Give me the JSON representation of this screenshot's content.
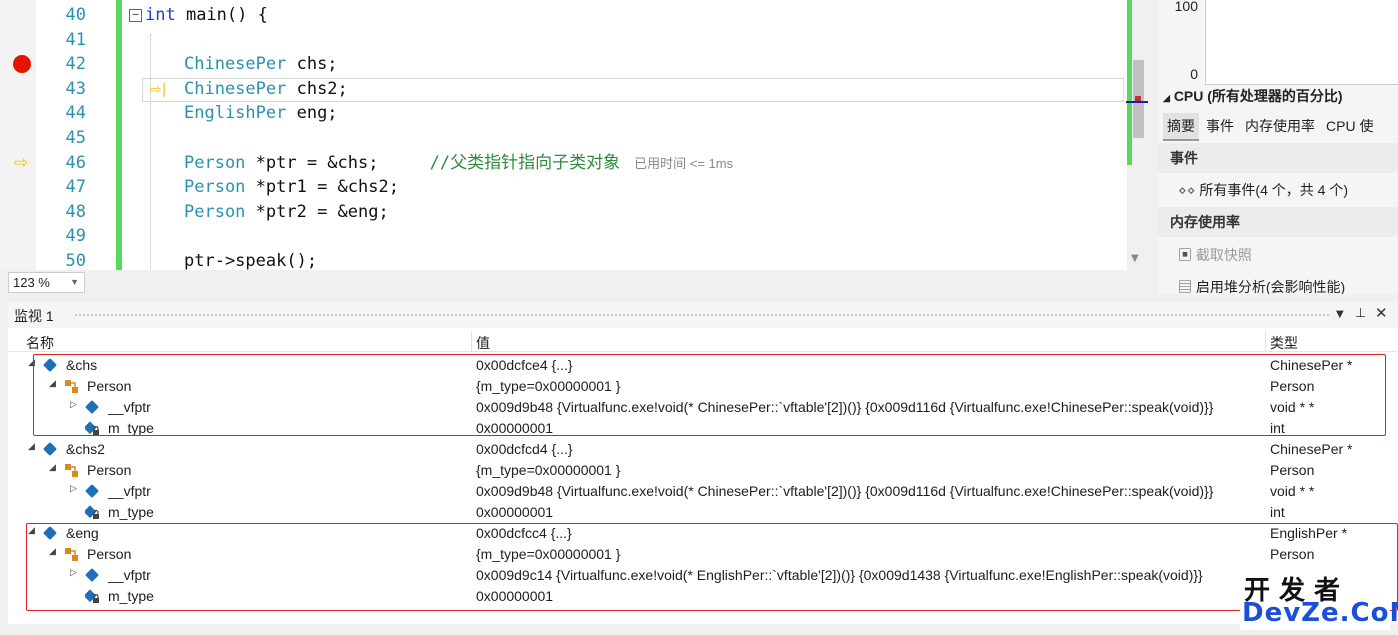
{
  "editor": {
    "zoom": "123 %",
    "lines": [
      {
        "num": "40",
        "segments": [
          {
            "t": "int",
            "c": "kw"
          },
          {
            "t": " main() {",
            "c": ""
          }
        ]
      },
      {
        "num": "41",
        "segments": []
      },
      {
        "num": "42",
        "segments": [
          {
            "t": "ChinesePer",
            "c": "ty"
          },
          {
            "t": " chs;",
            "c": ""
          }
        ]
      },
      {
        "num": "43",
        "segments": [
          {
            "t": "ChinesePer",
            "c": "ty"
          },
          {
            "t": " chs2;",
            "c": ""
          }
        ]
      },
      {
        "num": "44",
        "segments": [
          {
            "t": "EnglishPer",
            "c": "ty"
          },
          {
            "t": " eng;",
            "c": ""
          }
        ]
      },
      {
        "num": "45",
        "segments": []
      },
      {
        "num": "46",
        "segments": [
          {
            "t": "Person",
            "c": "ty"
          },
          {
            "t": " *ptr = &chs;     ",
            "c": ""
          },
          {
            "t": "//父类指针指向子类对象",
            "c": "cm"
          }
        ]
      },
      {
        "num": "47",
        "segments": [
          {
            "t": "Person",
            "c": "ty"
          },
          {
            "t": " *ptr1 = &chs2;",
            "c": ""
          }
        ]
      },
      {
        "num": "48",
        "segments": [
          {
            "t": "Person",
            "c": "ty"
          },
          {
            "t": " *ptr2 = &eng;",
            "c": ""
          }
        ]
      },
      {
        "num": "49",
        "segments": []
      },
      {
        "num": "50",
        "segments": [
          {
            "t": "ptr->speak();",
            "c": ""
          }
        ]
      }
    ],
    "elapsed_hint": "已用时间 <= 1ms",
    "collapse_glyph": "−",
    "step_glyph": "⇨|",
    "next_glyph": "⇨"
  },
  "diagnostics": {
    "y_max": "100",
    "y_min": "0",
    "cpu_title": "CPU (所有处理器的百分比)",
    "tabs": [
      "摘要",
      "事件",
      "内存使用率",
      "CPU 使"
    ],
    "events_header": "事件",
    "all_events": "所有事件(4 个，共 4 个)",
    "memory_header": "内存使用率",
    "snapshot": "截取快照",
    "heap_analysis": "启用堆分析(会影响性能)"
  },
  "watch": {
    "title": "监视 1",
    "columns": {
      "name": "名称",
      "value": "值",
      "type": "类型"
    },
    "rows": [
      {
        "indent": 0,
        "expander": "◢",
        "icon": "obj",
        "name": "&chs",
        "value": "0x00dcfce4 {...}",
        "type": "ChinesePer *"
      },
      {
        "indent": 1,
        "expander": "◢",
        "icon": "base",
        "name": "Person",
        "value": "{m_type=0x00000001 }",
        "type": "Person"
      },
      {
        "indent": 2,
        "expander": "▷",
        "icon": "obj",
        "name": "__vfptr",
        "value": "0x009d9b48 {Virtualfunc.exe!void(* ChinesePer::`vftable'[2])()} {0x009d116d {Virtualfunc.exe!ChinesePer::speak(void)}}",
        "type": "void * *"
      },
      {
        "indent": 2,
        "expander": "",
        "icon": "lock",
        "name": "m_type",
        "value": "0x00000001",
        "type": "int"
      },
      {
        "indent": 0,
        "expander": "◢",
        "icon": "obj",
        "name": "&chs2",
        "value": "0x00dcfcd4 {...}",
        "type": "ChinesePer *"
      },
      {
        "indent": 1,
        "expander": "◢",
        "icon": "base",
        "name": "Person",
        "value": "{m_type=0x00000001 }",
        "type": "Person"
      },
      {
        "indent": 2,
        "expander": "▷",
        "icon": "obj",
        "name": "__vfptr",
        "value": "0x009d9b48 {Virtualfunc.exe!void(* ChinesePer::`vftable'[2])()} {0x009d116d {Virtualfunc.exe!ChinesePer::speak(void)}}",
        "type": "void * *"
      },
      {
        "indent": 2,
        "expander": "",
        "icon": "lock",
        "name": "m_type",
        "value": "0x00000001",
        "type": "int"
      },
      {
        "indent": 0,
        "expander": "◢",
        "icon": "obj",
        "name": "&eng",
        "value": "0x00dcfcc4 {...}",
        "type": "EnglishPer *"
      },
      {
        "indent": 1,
        "expander": "◢",
        "icon": "base",
        "name": "Person",
        "value": "{m_type=0x00000001 }",
        "type": "Person"
      },
      {
        "indent": 2,
        "expander": "▷",
        "icon": "obj",
        "name": "__vfptr",
        "value": "0x009d9c14 {Virtualfunc.exe!void(* EnglishPer::`vftable'[2])()} {0x009d1438 {Virtualfunc.exe!EnglishPer::speak(void)}}",
        "type": ""
      },
      {
        "indent": 2,
        "expander": "",
        "icon": "lock",
        "name": "m_type",
        "value": "0x00000001",
        "type": ""
      }
    ]
  },
  "watermark": {
    "line1": "开发者",
    "line2": "DevZe.CoM"
  },
  "colors": {
    "breakpoint": "#e51400",
    "change_bar": "#57d95e",
    "highlight_box": "#d22222",
    "object_icon": "#1c6fb8"
  }
}
